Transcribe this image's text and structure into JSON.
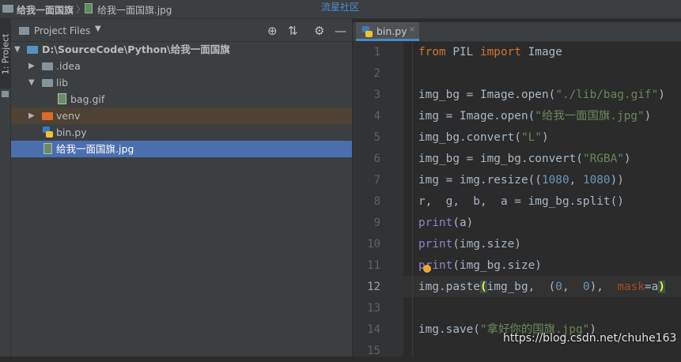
{
  "breadcrumb": {
    "folder": "给我一面国旗",
    "file": "给我一面国旗.jpg"
  },
  "top_watermark": "流星社区",
  "left_strip": {
    "project_tab": "1: Project"
  },
  "project_panel": {
    "title": "Project Files",
    "dropdown": "▼",
    "tools": {
      "target": "⊕",
      "collapse": "⇅",
      "settings": "⚙",
      "minimize": "—"
    },
    "tree": [
      {
        "label": "D:\\SourceCode\\Python\\给我一面国旗",
        "arrow": "▼"
      },
      {
        "label": ".idea",
        "arrow": "▶"
      },
      {
        "label": "lib",
        "arrow": "▼"
      },
      {
        "label": "bag.gif"
      },
      {
        "label": "venv",
        "arrow": "▶"
      },
      {
        "label": "bin.py"
      },
      {
        "label": "给我一面国旗.jpg"
      }
    ]
  },
  "editor": {
    "tab": {
      "name": "bin.py",
      "close": "×"
    },
    "line_numbers": [
      "1",
      "2",
      "3",
      "4",
      "5",
      "6",
      "7",
      "8",
      "9",
      "10",
      "11",
      "12",
      "13",
      "14",
      "15"
    ],
    "current_line": 12
  },
  "code": {
    "l1": [
      "from",
      " PIL ",
      "import",
      " Image"
    ],
    "l3": [
      "img_bg = Image.open(",
      "\"./lib/bag.gif\"",
      ")"
    ],
    "l4": [
      "img = Image.open(",
      "\"给我一面国旗.jpg\"",
      ")"
    ],
    "l5": [
      "img_bg.convert(",
      "\"L\"",
      ")"
    ],
    "l6": [
      "img_bg = img_bg.convert(",
      "\"RGBA\"",
      ")"
    ],
    "l7": [
      "img = img.resize((",
      "1080",
      ", ",
      "1080",
      "))"
    ],
    "l8": "r,  g,  b,  a = img_bg.split()",
    "l9": [
      "print",
      "(a)"
    ],
    "l10": [
      "print",
      "(img.size)"
    ],
    "l11": [
      "print",
      "(img_bg.size)"
    ],
    "l12": [
      "img.paste",
      "(",
      "img_bg,  (",
      "0",
      ",  ",
      "0",
      "),  ",
      "mask",
      "=a",
      ")"
    ],
    "l14": [
      "img.save(",
      "\"拿好你的国旗.jpg\"",
      ")"
    ]
  },
  "bottom_watermark": "https://blog.csdn.net/chuhe163",
  "colors": {
    "selection": "#4b6eaf",
    "keyword": "#cc7832",
    "string": "#6a8759",
    "number": "#6897bb",
    "builtin": "#8888c6"
  }
}
